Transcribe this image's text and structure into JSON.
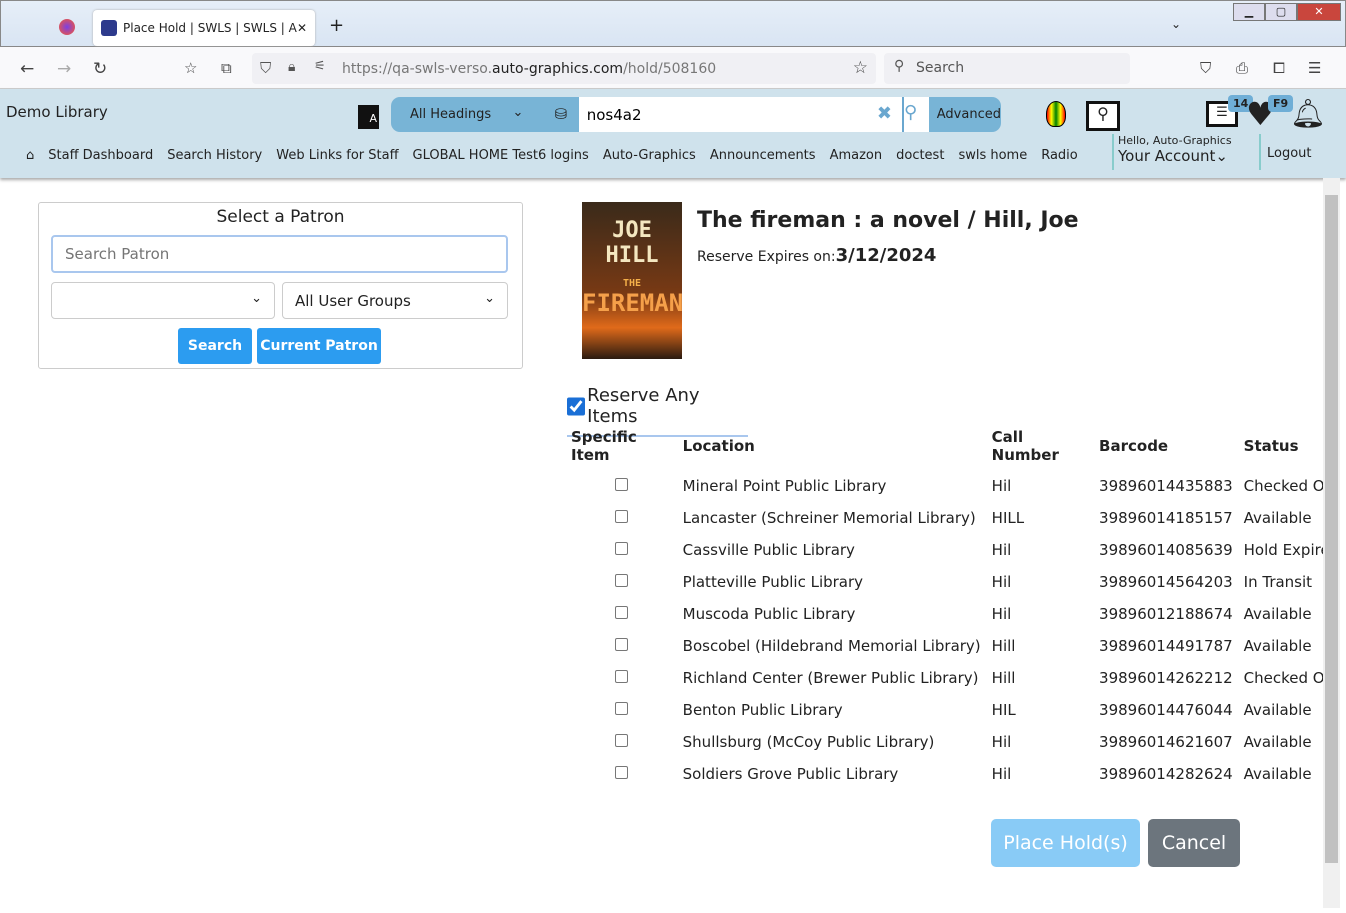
{
  "browser": {
    "tab_title": "Place Hold | SWLS | SWLS | Auto-Graphics",
    "url_prefix": "https://qa-swls-verso.",
    "url_domain": "auto-graphics.com",
    "url_path": "/hold/508160",
    "search_placeholder": "Search"
  },
  "header": {
    "library": "Demo Library",
    "search_type": "All Headings",
    "search_value": "nos4a2",
    "advanced": "Advanced",
    "badge_list": "14",
    "badge_fav": "F9",
    "hello": "Hello, Auto-Graphics",
    "account": "Your Account",
    "logout": "Logout",
    "links": [
      "Staff Dashboard",
      "Search History",
      "Web Links for Staff",
      "GLOBAL HOME Test6 logins",
      "Auto-Graphics",
      "Announcements",
      "Amazon",
      "doctest",
      "swls home",
      "Radio"
    ]
  },
  "patron": {
    "title": "Select a Patron",
    "placeholder": "Search Patron",
    "group": "All User Groups",
    "search": "Search",
    "current": "Current Patron"
  },
  "record": {
    "cover_author": "JOE HILL",
    "cover_the": "THE",
    "cover_title": "FIREMAN",
    "title": "The fireman : a novel / Hill, Joe",
    "expires_label": "Reserve Expires on:",
    "expires": "3/12/2024",
    "reserve_any": "Reserve Any Items",
    "reserve_any_checked": true
  },
  "table": {
    "headers": [
      "Specific Item",
      "Location",
      "Call Number",
      "Barcode",
      "Status"
    ],
    "rows": [
      [
        "Mineral Point Public Library",
        "Hil",
        "39896014435883",
        "Checked Out"
      ],
      [
        "Lancaster (Schreiner Memorial Library)",
        "HILL",
        "39896014185157",
        "Available"
      ],
      [
        "Cassville Public Library",
        "Hil",
        "39896014085639",
        "Hold Expired"
      ],
      [
        "Platteville Public Library",
        "Hil",
        "39896014564203",
        "In Transit"
      ],
      [
        "Muscoda Public Library",
        "Hil",
        "39896012188674",
        "Available"
      ],
      [
        "Boscobel (Hildebrand Memorial Library)",
        "Hill",
        "39896014491787",
        "Available"
      ],
      [
        "Richland Center (Brewer Public Library)",
        "Hill",
        "39896014262212",
        "Checked Out"
      ],
      [
        "Benton Public Library",
        "HIL",
        "39896014476044",
        "Available"
      ],
      [
        "Shullsburg (McCoy Public Library)",
        "Hil",
        "39896014621607",
        "Available"
      ],
      [
        "Soldiers Grove Public Library",
        "Hil",
        "39896014282624",
        "Available"
      ]
    ]
  },
  "actions": {
    "place": "Place Hold(s)",
    "cancel": "Cancel"
  }
}
